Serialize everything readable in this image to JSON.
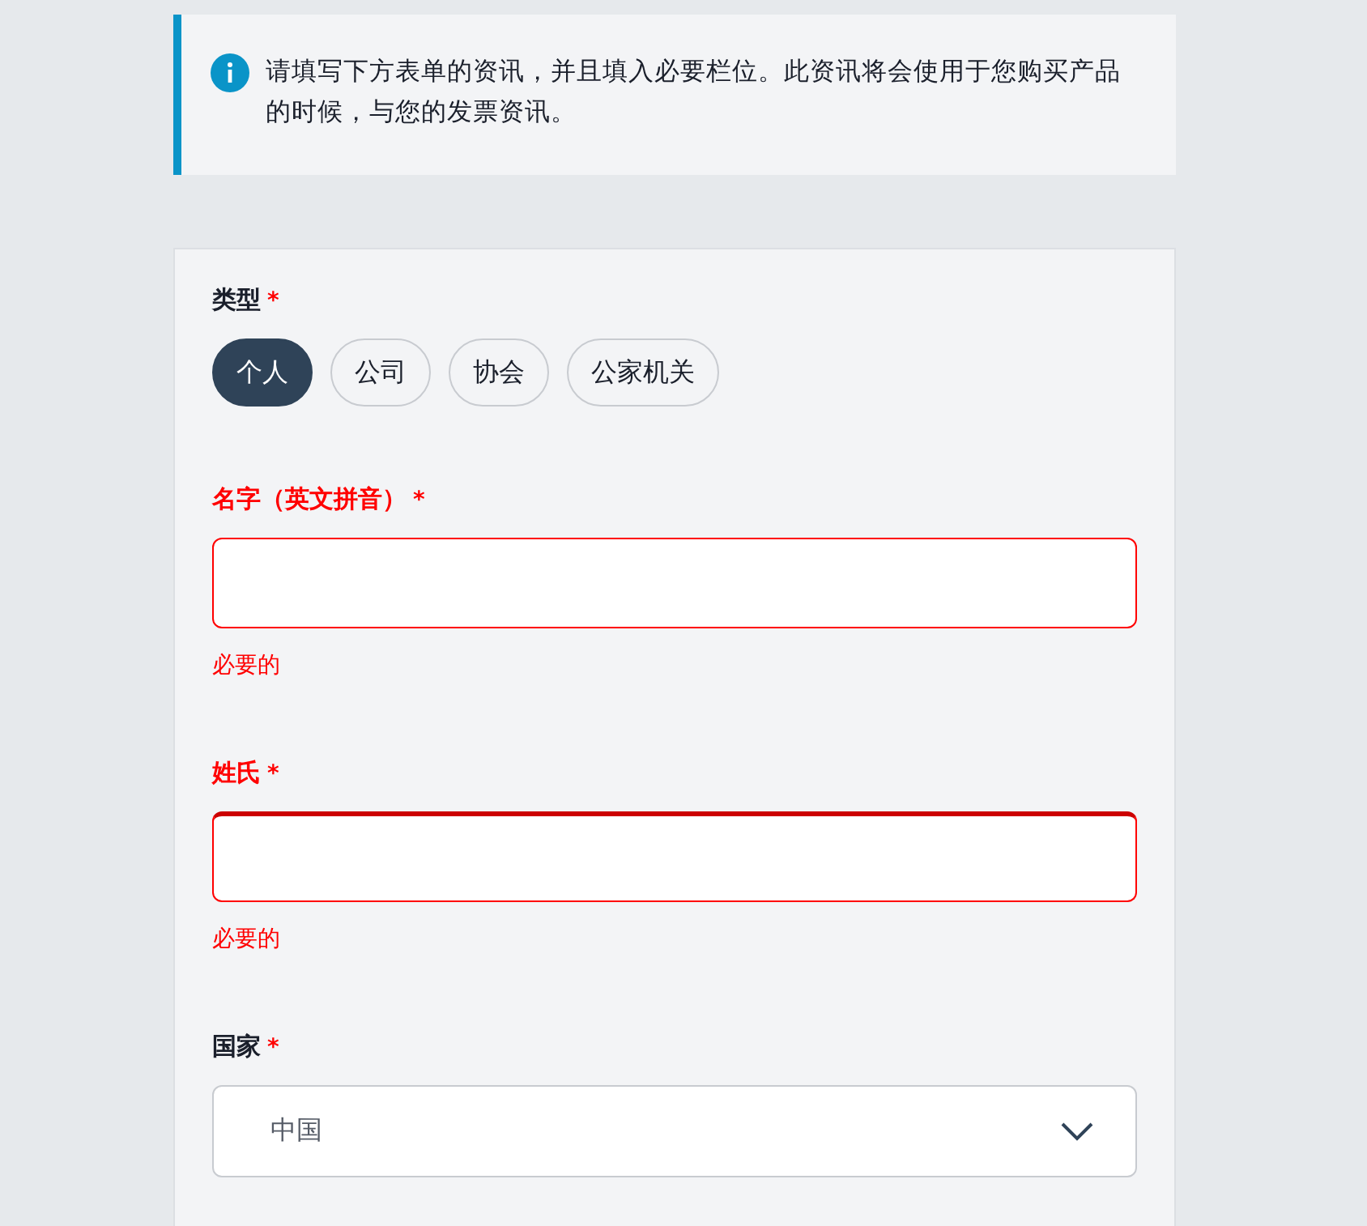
{
  "notice": {
    "text": "请填写下方表单的资讯，并且填入必要栏位。此资讯将会使用于您购买产品的时候，与您的发票资讯。"
  },
  "fields": [
    {
      "kind": "choice",
      "label": "类型",
      "required_mark": "*",
      "error": false,
      "options": [
        {
          "label": "个人",
          "selected": true
        },
        {
          "label": "公司",
          "selected": false
        },
        {
          "label": "协会",
          "selected": false
        },
        {
          "label": "公家机关",
          "selected": false
        }
      ]
    },
    {
      "kind": "text",
      "label": "名字（英文拼音）",
      "required_mark": "*",
      "error": true,
      "focused": false,
      "help": "必要的"
    },
    {
      "kind": "text",
      "label": "姓氏",
      "required_mark": "*",
      "error": true,
      "focused": true,
      "help": "必要的"
    },
    {
      "kind": "select",
      "label": "国家",
      "required_mark": "*",
      "error": false,
      "value": "中国"
    }
  ]
}
